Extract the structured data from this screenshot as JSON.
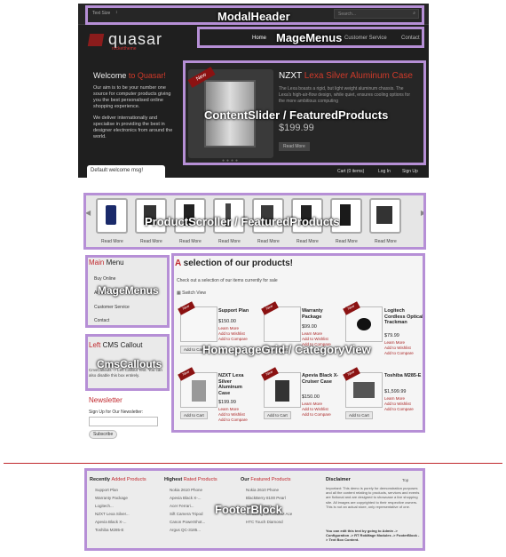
{
  "annotations": {
    "modal_header": "ModalHeader",
    "mage_menus_top": "MageMenus",
    "content_slider": "ContentSlider / FeaturedProducts",
    "product_scroller": "ProductScroller / FeaturedProducts",
    "mage_menus_side": "MageMenus",
    "cms_callouts": "CmsCallouts",
    "homepage_grid": "HomepageGrid / CategoryView",
    "footer_block": "FooterBlock"
  },
  "header": {
    "text_size_label": "Text Size",
    "search_placeholder": "Search...",
    "logo_text": "quasar",
    "logo_tagline": "rockettheme"
  },
  "nav": [
    "Home",
    "Customer Service",
    "Contact"
  ],
  "welcome": {
    "title_prefix": "Welcome",
    "title_to": "to Quasar!",
    "para1": "Our aim is to be your number one source for computer products giving you the best personalised online shopping experience.",
    "para2": "We deliver internationally and specialise in providing the best in designer electronics from around the world."
  },
  "slider": {
    "badge": "New",
    "brand": "NZXT",
    "title": "Lexa Silver Aluminum Case",
    "desc": "The Lexa boasts a rigid, but light weight aluminum chassis. The Lexa's high-air-flow design, while quiet, ensures cooling options for the more ambitious computing",
    "price": "$199.99",
    "more": "Read More"
  },
  "bar": {
    "welcome_msg": "Default welcome msg!",
    "cart": "Cart (0 items)",
    "login": "Log In",
    "signup": "Sign Up"
  },
  "scroller": {
    "read_more": "Read More"
  },
  "sidebar": {
    "menu_title_main": "Main",
    "menu_title_rest": "Menu",
    "items": [
      "Buy Online",
      "About Us",
      "Customer Service",
      "Contact"
    ],
    "callout_left": "Left",
    "callout_rest": "CMS Callout",
    "callout_text": "CmsCallouts -> Left Callout Text. You can also disable this box entirely.",
    "newsletter_title": "Newsletter",
    "newsletter_label": "Sign Up for Our Newsletter:",
    "subscribe": "Subscribe"
  },
  "grid": {
    "heading_a": "A",
    "heading_rest": "selection of our products!",
    "intro": "Check out a selection of our items currently for sale",
    "switch_view": "Switch View",
    "badge": "New",
    "learn_more": "Learn More",
    "add_wishlist": "Add to Wishlist",
    "add_compare": "Add to Compare",
    "add_to_cart": "Add to Cart",
    "products": [
      {
        "name": "Support Plan",
        "price": "$150.00"
      },
      {
        "name": "Warranty Package",
        "price": "$99.00"
      },
      {
        "name": "Logitech Cordless Optical Trackman",
        "price": "$79.99"
      },
      {
        "name": "NZXT Lexa Silver Aluminum Case",
        "price": "$199.99"
      },
      {
        "name": "Apevia Black X-Cruiser Case",
        "price": "$150.00"
      },
      {
        "name": "Toshiba M285-E",
        "price": "$1,599.99"
      }
    ]
  },
  "footer": {
    "col1_a": "Recently",
    "col1_b": "Added Products",
    "col2_a": "Highest",
    "col2_b": "Rated Products",
    "col3_a": "Our",
    "col3_b": "Featured Products",
    "col4": "Disclaimer",
    "top": "Top",
    "col1_items": [
      "Support Plan",
      "Warranty Package",
      "Logitech...",
      "NZXT Lexa Silver...",
      "Apevia Black X-...",
      "Toshiba M285-E"
    ],
    "col2_items": [
      "Nokia 2610 Phone",
      "Apevia Black X-...",
      "Acer Ferrari...",
      "Sift Camera Tripod",
      "Canon PowerShot...",
      "Argus QC-3185..."
    ],
    "col3_items": [
      "Nokia 2610 Phone",
      "BlackBerry 8100 Pearl",
      "Sony Ericsson...",
      "Samsung MM-A900M Ace",
      "HTC Touch Diamond"
    ],
    "disclaimer": "Important: This demo is purely for demonstration purposes and all the content relating to products, services and events are fictional and are designed to showcase a live shopping site. All images are copyrighted to their respective owners. This is not an actual store, only representative of one.",
    "disclaimer2": "You can edit this text by going to Admin -> Configuration -> RT RokMage Modules -> FooterBlock -> Text Box Content."
  },
  "colors": {
    "accent": "#c0282d",
    "highlight": "#b68fd6"
  }
}
